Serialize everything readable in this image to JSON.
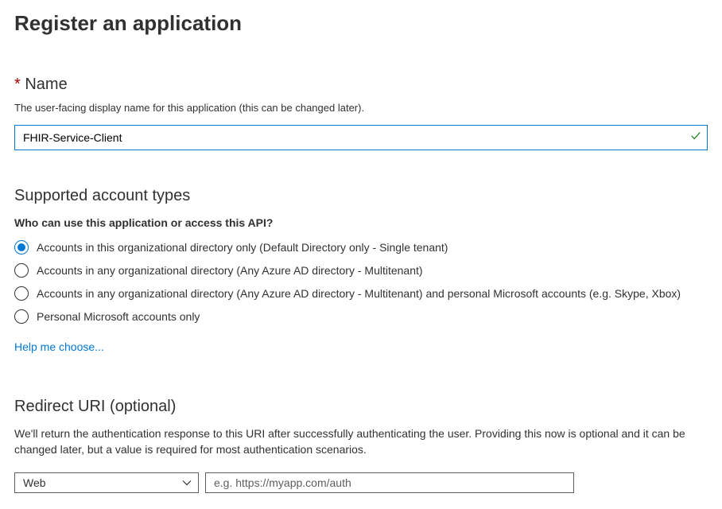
{
  "page_title": "Register an application",
  "name_section": {
    "label": "Name",
    "hint": "The user-facing display name for this application (this can be changed later).",
    "value": "FHIR-Service-Client"
  },
  "account_types": {
    "heading": "Supported account types",
    "question": "Who can use this application or access this API?",
    "options": [
      "Accounts in this organizational directory only (Default Directory only - Single tenant)",
      "Accounts in any organizational directory (Any Azure AD directory - Multitenant)",
      "Accounts in any organizational directory (Any Azure AD directory - Multitenant) and personal Microsoft accounts (e.g. Skype, Xbox)",
      "Personal Microsoft accounts only"
    ],
    "selected_index": 0,
    "help_link": "Help me choose..."
  },
  "redirect": {
    "heading": "Redirect URI (optional)",
    "description": "We'll return the authentication response to this URI after successfully authenticating the user. Providing this now is optional and it can be changed later, but a value is required for most authentication scenarios.",
    "type_selected": "Web",
    "uri_placeholder": "e.g. https://myapp.com/auth",
    "uri_value": ""
  }
}
